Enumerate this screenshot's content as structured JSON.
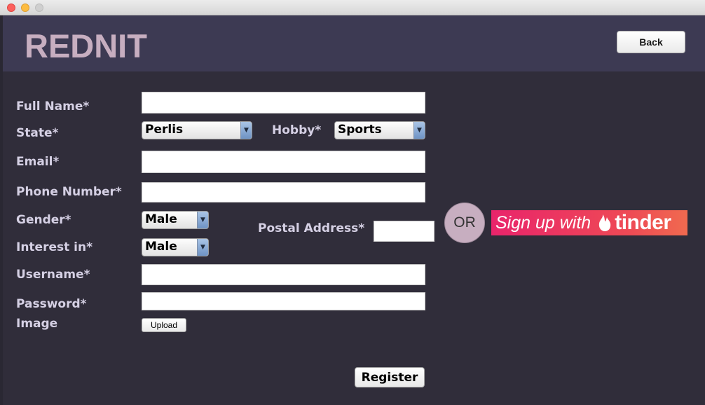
{
  "window": {
    "controls": [
      "close",
      "minimize",
      "maximize"
    ]
  },
  "header": {
    "logo": "REDNIT",
    "back_label": "Back"
  },
  "form": {
    "full_name": {
      "label": "Full Name*",
      "value": ""
    },
    "state": {
      "label": "State*",
      "selected": "Perlis"
    },
    "hobby": {
      "label": "Hobby*",
      "selected": "Sports"
    },
    "email": {
      "label": "Email*",
      "value": ""
    },
    "phone": {
      "label": "Phone Number*",
      "value": ""
    },
    "gender": {
      "label": "Gender*",
      "selected": "Male"
    },
    "interest": {
      "label": "Interest in*",
      "selected": "Male"
    },
    "postal_address": {
      "label": "Postal Address*",
      "value": ""
    },
    "username": {
      "label": "Username*",
      "value": ""
    },
    "password": {
      "label": "Password*",
      "value": ""
    },
    "image": {
      "label": "Image",
      "upload_label": "Upload"
    },
    "register_label": "Register"
  },
  "alt_signup": {
    "or_label": "OR",
    "signup_text": "Sign up with",
    "brand": "tinder",
    "brand_icon": "flame-icon"
  },
  "colors": {
    "background": "#302d3a",
    "header": "#3d3a53",
    "logo": "#c7aec0",
    "label": "#d5d0e4",
    "tinder_start": "#e9246b",
    "tinder_end": "#f06a4f"
  }
}
